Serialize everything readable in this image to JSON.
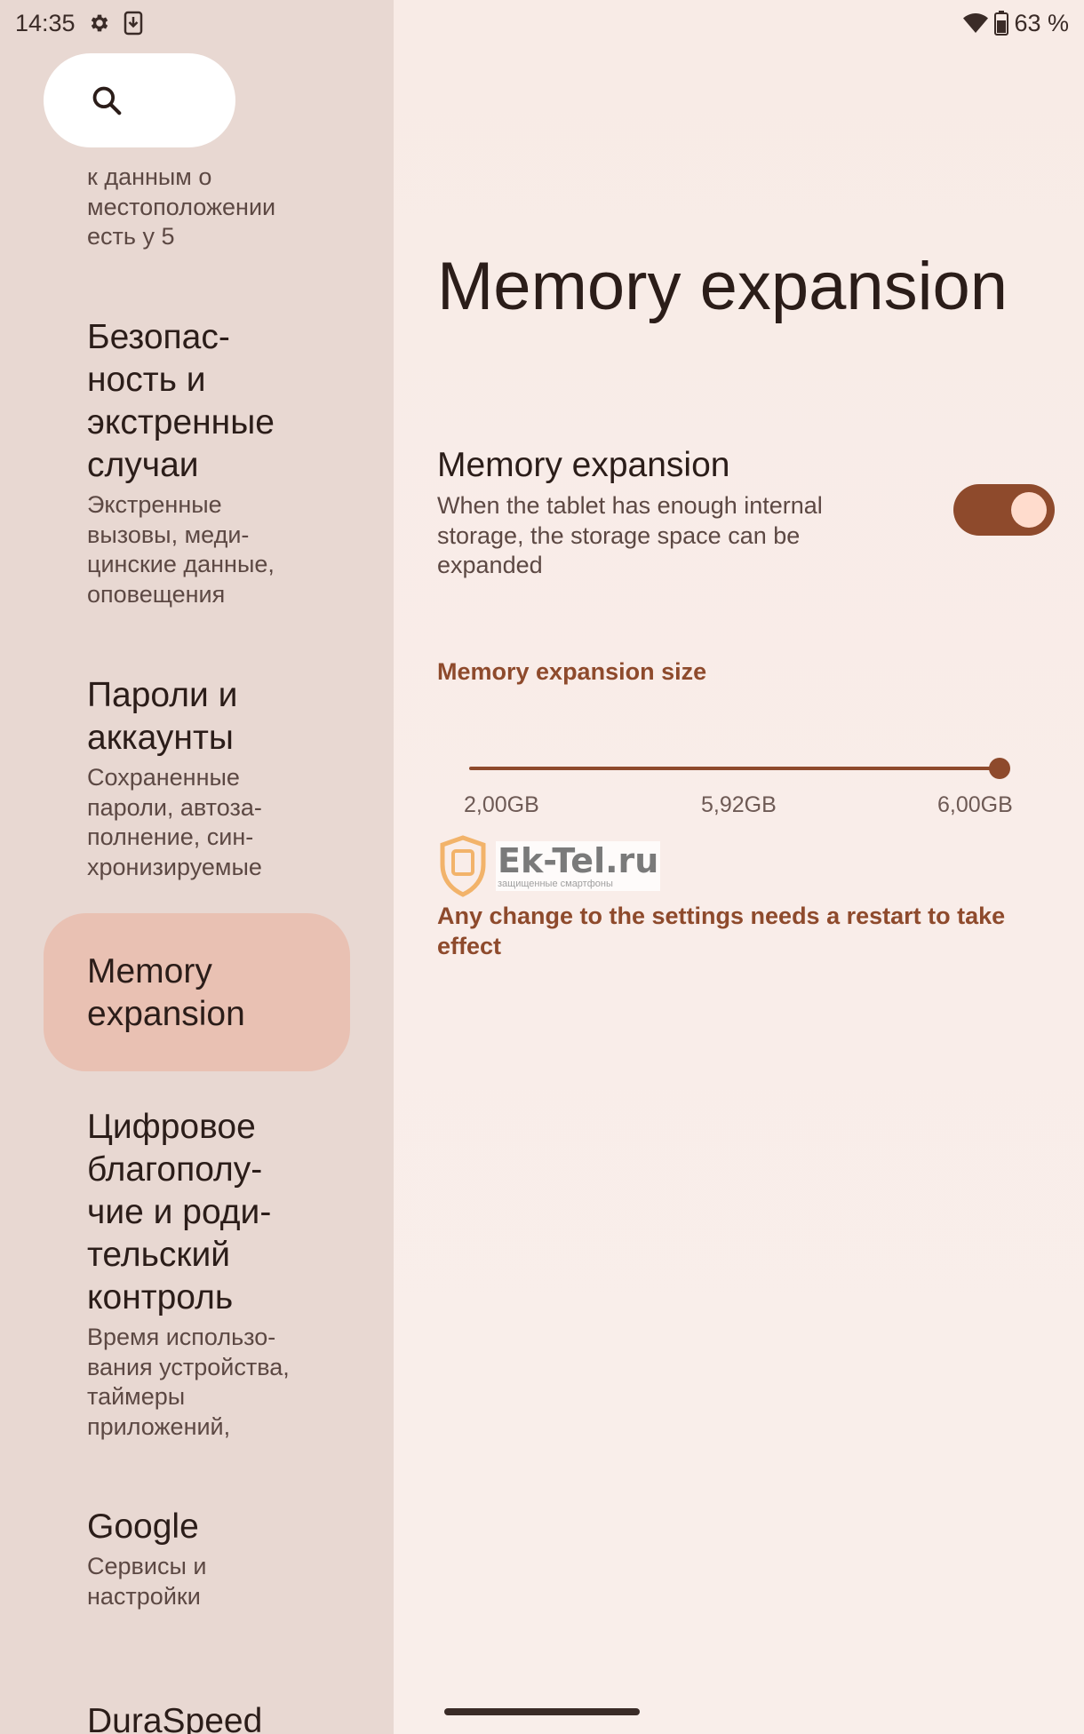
{
  "status_bar": {
    "time": "14:35",
    "battery": "63 %",
    "icons": [
      "gear-icon",
      "download-icon",
      "wifi-icon",
      "battery-icon"
    ]
  },
  "search": {
    "icon": "search-icon"
  },
  "sidebar": {
    "items": [
      {
        "title": "",
        "subtitle": "к данным о\nместоположении\nесть у 5"
      },
      {
        "title": "Безопас-\nность и\nэкстренные\nслучаи",
        "subtitle": "Экстренные\nвызовы, меди-\nцинские данные,\nоповещения"
      },
      {
        "title": "Пароли и\nаккаунты",
        "subtitle": "Сохраненные\nпароли, автоза-\nполнение, син-\nхронизируемые"
      },
      {
        "title": "Memory\nexpansion",
        "subtitle": ""
      },
      {
        "title": "Цифровое\nблагополу-\nчие и роди-\nтельский\nконтроль",
        "subtitle": "Время использо-\nвания устройства,\nтаймеры\nприложений,"
      },
      {
        "title": "Google",
        "subtitle": "Сервисы и\nнастройки"
      },
      {
        "title": "DuraSpeed",
        "subtitle": ""
      }
    ]
  },
  "main": {
    "page_title": "Memory expansion",
    "pref_title": "Memory expansion",
    "pref_summary": "When the tablet has enough internal storage, the storage space can be expanded",
    "toggle_on": true,
    "section_header": "Memory expansion size",
    "slider": {
      "labels": [
        "2,00GB",
        "5,92GB",
        "6,00GB"
      ],
      "value_fraction": 1.0
    },
    "note": "Any change to the settings needs a restart to take effect"
  },
  "watermark": {
    "title": "Ek-Tel.ru",
    "subtitle": "защищенные смартфоны"
  },
  "colors": {
    "accent": "#8e4a2c",
    "sidebar_bg": "#e8d8d2",
    "active_item": "#e9c1b3",
    "main_bg": "#f8ebe6"
  }
}
